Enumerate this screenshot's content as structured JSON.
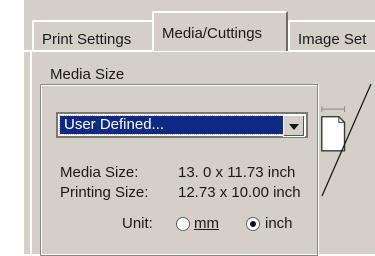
{
  "tabs": [
    {
      "label": "Print Settings"
    },
    {
      "label": "Media/Cuttings"
    },
    {
      "label": "Image Set"
    }
  ],
  "media_size_group": {
    "title": "Media Size",
    "select_value": "User Defined...",
    "media_size_label": "Media Size:",
    "media_size_value": "13. 0 x 11.73 inch",
    "printing_size_label": "Printing Size:",
    "printing_size_value": "12.73 x 10.00 inch",
    "unit_label": "Unit:",
    "unit_options": [
      {
        "label": "mm",
        "selected": false
      },
      {
        "label": "inch",
        "selected": true
      }
    ]
  },
  "icons": {
    "page_orientation": "portrait-page-icon",
    "dropdown": "chevron-down-icon"
  },
  "colors": {
    "dialog_bg": "#d4d0c8",
    "selection_bg": "#102a84"
  }
}
